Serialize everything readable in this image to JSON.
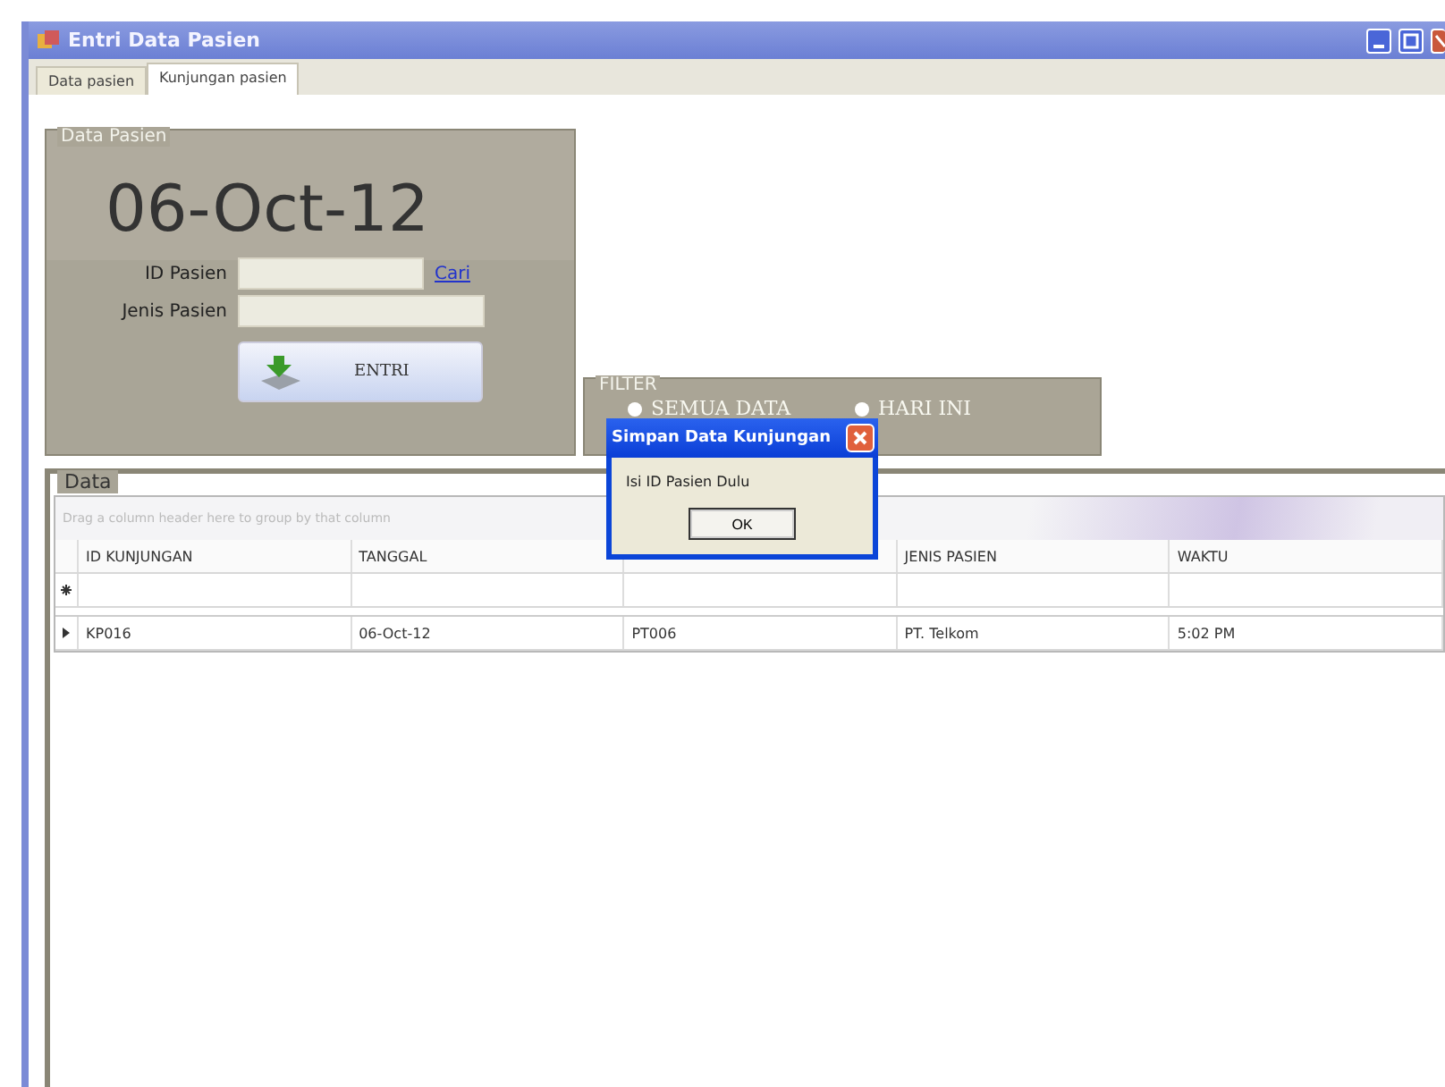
{
  "window": {
    "title": "Entri Data Pasien"
  },
  "tabs": [
    {
      "label": "Data pasien",
      "selected": false
    },
    {
      "label": "Kunjungan pasien",
      "selected": true
    }
  ],
  "data_pasien": {
    "legend": "Data Pasien",
    "date": "06-Oct-12",
    "id_label": "ID Pasien",
    "search_link": "Cari",
    "jenis_label": "Jenis Pasien",
    "entri_button": "ENTRI"
  },
  "filter": {
    "legend": "FILTER",
    "options": [
      {
        "label": "SEMUA DATA",
        "selected": false
      },
      {
        "label": "HARI INI",
        "selected": false
      }
    ]
  },
  "data": {
    "legend": "Data",
    "group_hint": "Drag a column header here to group by that column",
    "columns": [
      {
        "label": "ID KUNJUNGAN"
      },
      {
        "label": "TANGGAL"
      },
      {},
      {
        "label": "JENIS PASIEN"
      },
      {
        "label": "WAKTU"
      }
    ],
    "rows": [
      {
        "kind": "new",
        "cells": [
          "",
          "",
          "",
          "",
          ""
        ]
      },
      {
        "kind": "current",
        "cells": [
          "KP016",
          "06-Oct-12",
          "PT006",
          "PT. Telkom",
          "5:02 PM"
        ]
      }
    ]
  },
  "dialog": {
    "title": "Simpan Data Kunjungan",
    "message": "Isi ID Pasien Dulu",
    "button": "OK"
  }
}
